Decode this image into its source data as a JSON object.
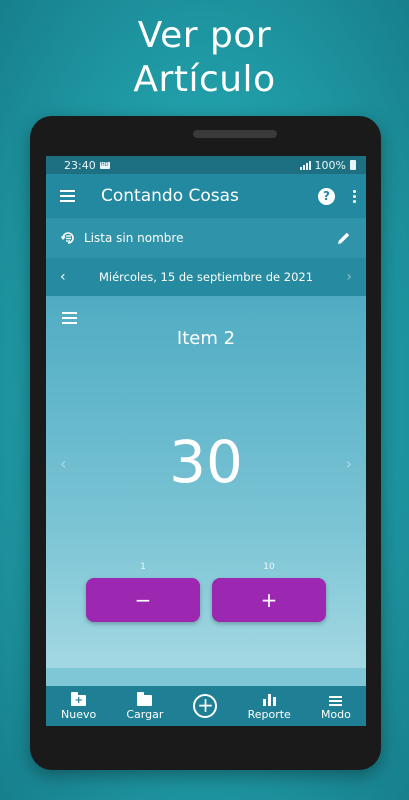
{
  "promo": {
    "line1": "Ver por",
    "line2": "Artículo"
  },
  "status": {
    "time": "23:40",
    "battery": "100%"
  },
  "appbar": {
    "title": "Contando Cosas",
    "help": "?"
  },
  "list": {
    "name": "Lista sin nombre"
  },
  "date": {
    "text": "Miércoles, 15 de septiembre de 2021"
  },
  "counter": {
    "item_name": "Item 2",
    "value": "30",
    "minus_step": "1",
    "plus_step": "10",
    "minus_label": "−",
    "plus_label": "+"
  },
  "nav": {
    "items": [
      {
        "label": "Nuevo",
        "icon": "new-folder-icon"
      },
      {
        "label": "Cargar",
        "icon": "folder-icon"
      },
      {
        "label": "",
        "icon": "add-circle-icon"
      },
      {
        "label": "Reporte",
        "icon": "bar-chart-icon"
      },
      {
        "label": "Modo",
        "icon": "list-icon"
      }
    ]
  },
  "colors": {
    "accent": "#9c27b0",
    "appbar": "#2389a0",
    "background": "#22a3ad"
  }
}
